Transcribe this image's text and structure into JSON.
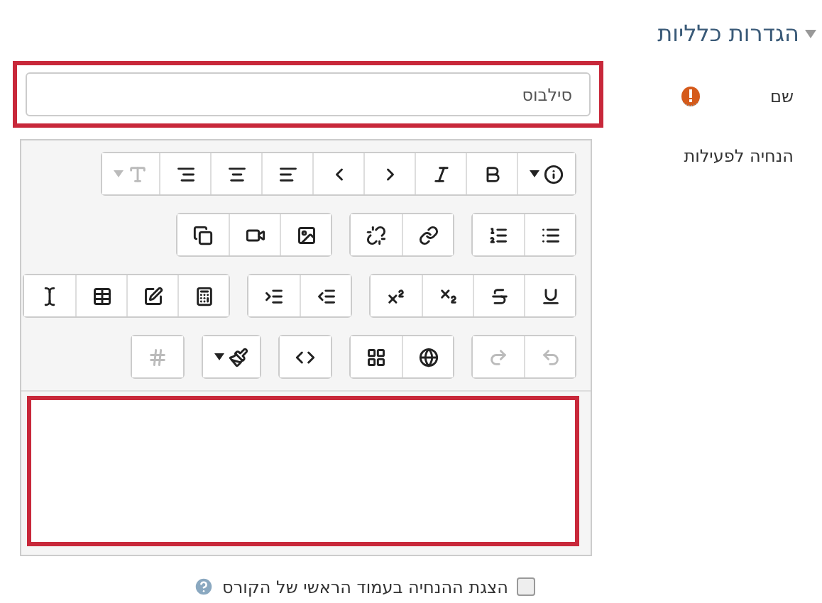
{
  "section": {
    "title": "הגדרות כלליות",
    "expanded": true
  },
  "name_field": {
    "label": "שם",
    "required": true,
    "value": "סילבוס"
  },
  "intro": {
    "label": "הנחיה לפעילות",
    "toolbar_rows": [
      [
        [
          {
            "kind": "info",
            "dropdown": true,
            "disabled": false
          },
          {
            "kind": "bold",
            "dropdown": false,
            "disabled": false
          },
          {
            "kind": "italic",
            "dropdown": false,
            "disabled": false
          },
          {
            "kind": "chevron-right",
            "dropdown": false,
            "disabled": false
          },
          {
            "kind": "chevron-left",
            "dropdown": false,
            "disabled": false
          },
          {
            "kind": "align-left",
            "dropdown": false,
            "disabled": false
          },
          {
            "kind": "align-center",
            "dropdown": false,
            "disabled": false
          },
          {
            "kind": "align-right",
            "dropdown": false,
            "disabled": false
          },
          {
            "kind": "font-size",
            "dropdown": true,
            "disabled": true
          }
        ]
      ],
      [
        [
          {
            "kind": "bullet-list",
            "dropdown": false,
            "disabled": false
          },
          {
            "kind": "numbered-list",
            "dropdown": false,
            "disabled": false
          }
        ],
        [
          {
            "kind": "link",
            "dropdown": false,
            "disabled": false
          },
          {
            "kind": "unlink",
            "dropdown": false,
            "disabled": false
          }
        ],
        [
          {
            "kind": "image",
            "dropdown": false,
            "disabled": false
          },
          {
            "kind": "video",
            "dropdown": false,
            "disabled": false
          },
          {
            "kind": "files",
            "dropdown": false,
            "disabled": false
          }
        ]
      ],
      [
        [
          {
            "kind": "underline",
            "dropdown": false,
            "disabled": false
          },
          {
            "kind": "strikethrough",
            "dropdown": false,
            "disabled": false
          },
          {
            "kind": "subscript",
            "dropdown": false,
            "disabled": false
          },
          {
            "kind": "superscript",
            "dropdown": false,
            "disabled": false
          }
        ],
        [
          {
            "kind": "indent-decrease",
            "dropdown": false,
            "disabled": false
          },
          {
            "kind": "indent-increase",
            "dropdown": false,
            "disabled": false
          }
        ],
        [
          {
            "kind": "calculator",
            "dropdown": false,
            "disabled": false
          },
          {
            "kind": "edit",
            "dropdown": false,
            "disabled": false
          },
          {
            "kind": "table",
            "dropdown": false,
            "disabled": false
          },
          {
            "kind": "text-cursor",
            "dropdown": false,
            "disabled": false
          }
        ]
      ],
      [
        [
          {
            "kind": "undo",
            "dropdown": false,
            "disabled": true
          },
          {
            "kind": "redo",
            "dropdown": false,
            "disabled": true
          }
        ],
        [
          {
            "kind": "globe",
            "dropdown": false,
            "disabled": false
          },
          {
            "kind": "grid",
            "dropdown": false,
            "disabled": false
          }
        ],
        [
          {
            "kind": "code",
            "dropdown": false,
            "disabled": false
          }
        ],
        [
          {
            "kind": "brush",
            "dropdown": true,
            "disabled": false
          }
        ],
        [
          {
            "kind": "hash",
            "dropdown": false,
            "disabled": true
          }
        ]
      ]
    ]
  },
  "show_on_course_page": {
    "label": "הצגת ההנחיה בעמוד הראשי של הקורס",
    "checked": false
  }
}
